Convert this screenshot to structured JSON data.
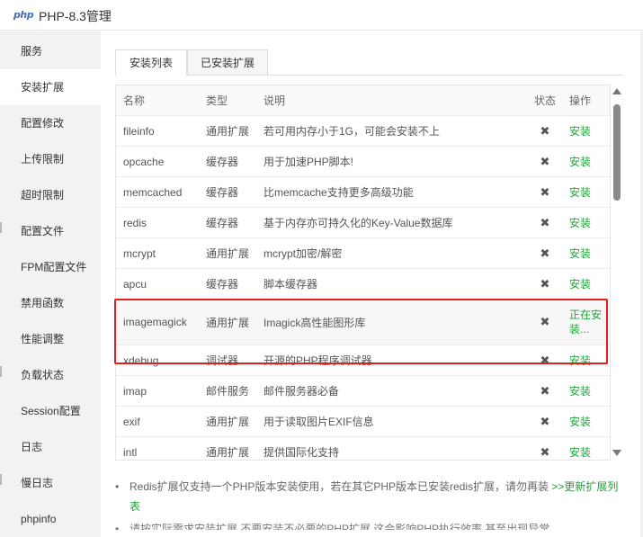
{
  "window": {
    "logo_text": "php",
    "title": "PHP-8.3管理"
  },
  "sidebar": {
    "items": [
      {
        "label": "服务"
      },
      {
        "label": "安装扩展"
      },
      {
        "label": "配置修改"
      },
      {
        "label": "上传限制"
      },
      {
        "label": "超时限制"
      },
      {
        "label": "配置文件"
      },
      {
        "label": "FPM配置文件"
      },
      {
        "label": "禁用函数"
      },
      {
        "label": "性能调整"
      },
      {
        "label": "负载状态"
      },
      {
        "label": "Session配置"
      },
      {
        "label": "日志"
      },
      {
        "label": "慢日志"
      },
      {
        "label": "phpinfo"
      }
    ],
    "active_index": 1
  },
  "tabs": [
    {
      "label": "安装列表"
    },
    {
      "label": "已安装扩展"
    }
  ],
  "table": {
    "headers": {
      "name": "名称",
      "type": "类型",
      "desc": "说明",
      "status": "状态",
      "op": "操作"
    },
    "status_icon": "x-icon",
    "status_glyph": "✖",
    "rows": [
      {
        "name": "fileinfo",
        "type": "通用扩展",
        "desc": "若可用内存小于1G，可能会安装不上",
        "op": "安装"
      },
      {
        "name": "opcache",
        "type": "缓存器",
        "desc": "用于加速PHP脚本!",
        "op": "安装"
      },
      {
        "name": "memcached",
        "type": "缓存器",
        "desc": "比memcache支持更多高级功能",
        "op": "安装"
      },
      {
        "name": "redis",
        "type": "缓存器",
        "desc": "基于内存亦可持久化的Key-Value数据库",
        "op": "安装"
      },
      {
        "name": "mcrypt",
        "type": "通用扩展",
        "desc": "mcrypt加密/解密",
        "op": "安装"
      },
      {
        "name": "apcu",
        "type": "缓存器",
        "desc": "脚本缓存器",
        "op": "安装"
      },
      {
        "name": "imagemagick",
        "type": "通用扩展",
        "desc": "Imagick高性能图形库",
        "op": "正在安装..."
      },
      {
        "name": "xdebug",
        "type": "调试器",
        "desc": "开源的PHP程序调试器",
        "op": "安装"
      },
      {
        "name": "imap",
        "type": "邮件服务",
        "desc": "邮件服务器必备",
        "op": "安装"
      },
      {
        "name": "exif",
        "type": "通用扩展",
        "desc": "用于读取图片EXIF信息",
        "op": "安装"
      },
      {
        "name": "intl",
        "type": "通用扩展",
        "desc": "提供国际化支持",
        "op": "安装"
      }
    ]
  },
  "notes": {
    "note1_text": "Redis扩展仅支持一个PHP版本安装使用，若在其它PHP版本已安装redis扩展，请勿再装",
    "note1_link": ">>更新扩展列表",
    "note2_text": "请按实际需求安装扩展,不要安装不必要的PHP扩展,这会影响PHP执行效率,甚至出现异常"
  },
  "colors": {
    "accent": "#20a53a",
    "highlight": "#e02020"
  }
}
